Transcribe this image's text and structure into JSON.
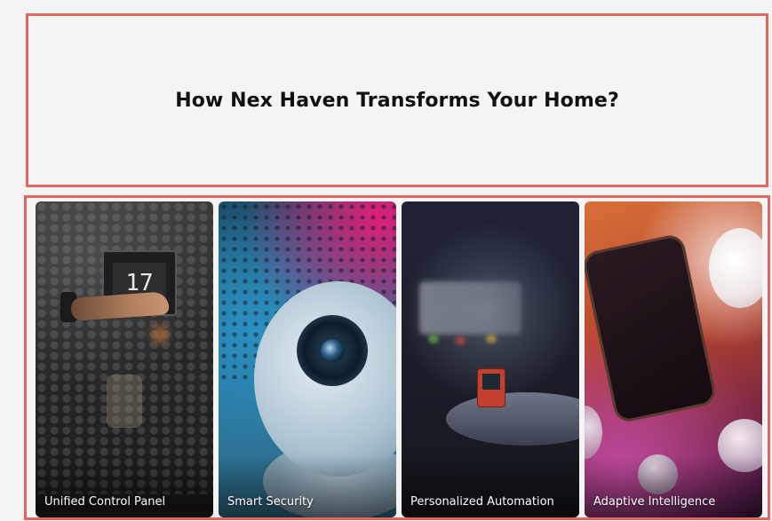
{
  "hero": {
    "title": "How Nex Haven Transforms Your Home?"
  },
  "cards": [
    {
      "label": "Unified Control Panel",
      "image": "thermostat-hand-photo"
    },
    {
      "label": "Smart Security",
      "image": "security-camera-photo"
    },
    {
      "label": "Personalized Automation",
      "image": "automation-device-photo"
    },
    {
      "label": "Adaptive Intelligence",
      "image": "smartphone-bulbs-photo"
    }
  ],
  "thermostat_reading": "17",
  "colors": {
    "outline": "#e2665f",
    "page_bg": "#f4f4f5",
    "title_text": "#111111",
    "card_label_text": "#ffffff"
  }
}
